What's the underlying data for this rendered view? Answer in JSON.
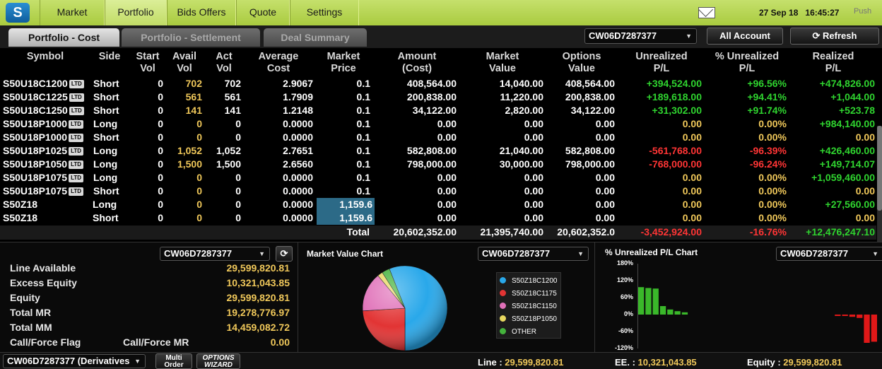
{
  "nav": {
    "logo": "S",
    "items": [
      "Market",
      "Portfolio",
      "Bids Offers",
      "Quote",
      "Settings"
    ],
    "active": "Portfolio",
    "date": "27 Sep 18",
    "time": "16:45:27",
    "push": "Push"
  },
  "tabs": [
    "Portfolio - Cost",
    "Portfolio - Settlement",
    "Deal Summary"
  ],
  "toolbar": {
    "account": "CW06D7287377",
    "all_account": "All Account",
    "refresh": "Refresh"
  },
  "table": {
    "headers": [
      [
        "Symbol",
        ""
      ],
      [
        "Side",
        ""
      ],
      [
        "Start",
        "Vol"
      ],
      [
        "Avail",
        "Vol"
      ],
      [
        "Act",
        "Vol"
      ],
      [
        "Average",
        "Cost"
      ],
      [
        "Market",
        "Price"
      ],
      [
        "Amount",
        "(Cost)"
      ],
      [
        "Market",
        "Value"
      ],
      [
        "Options",
        "Value"
      ],
      [
        "Unrealized",
        "P/L"
      ],
      [
        "% Unrealized",
        "P/L"
      ],
      [
        "Realized",
        "P/L"
      ]
    ],
    "ltd_label": "LTD",
    "rows": [
      {
        "symbol": "S50U18C1200",
        "ltd": true,
        "side": "Short",
        "start": "0",
        "avail": "702",
        "act": "702",
        "avg": "2.9067",
        "mkt": "0.1",
        "amount": "408,564.00",
        "mval": "14,040.00",
        "oval": "408,564.00",
        "unr": "+394,524.00",
        "pct": "+96.56%",
        "real": "+474,826.00"
      },
      {
        "symbol": "S50U18C1225",
        "ltd": true,
        "side": "Short",
        "start": "0",
        "avail": "561",
        "act": "561",
        "avg": "1.7909",
        "mkt": "0.1",
        "amount": "200,838.00",
        "mval": "11,220.00",
        "oval": "200,838.00",
        "unr": "+189,618.00",
        "pct": "+94.41%",
        "real": "+1,044.00"
      },
      {
        "symbol": "S50U18C1250",
        "ltd": true,
        "side": "Short",
        "start": "0",
        "avail": "141",
        "act": "141",
        "avg": "1.2148",
        "mkt": "0.1",
        "amount": "34,122.00",
        "mval": "2,820.00",
        "oval": "34,122.00",
        "unr": "+31,302.00",
        "pct": "+91.74%",
        "real": "+523.78"
      },
      {
        "symbol": "S50U18P1000",
        "ltd": true,
        "side": "Long",
        "start": "0",
        "avail": "0",
        "act": "0",
        "avg": "0.0000",
        "mkt": "0.1",
        "amount": "0.00",
        "mval": "0.00",
        "oval": "0.00",
        "unr": "0.00",
        "pct": "0.00%",
        "real": "+984,140.00"
      },
      {
        "symbol": "S50U18P1000",
        "ltd": true,
        "side": "Short",
        "start": "0",
        "avail": "0",
        "act": "0",
        "avg": "0.0000",
        "mkt": "0.1",
        "amount": "0.00",
        "mval": "0.00",
        "oval": "0.00",
        "unr": "0.00",
        "pct": "0.00%",
        "real": "0.00"
      },
      {
        "symbol": "S50U18P1025",
        "ltd": true,
        "side": "Long",
        "start": "0",
        "avail": "1,052",
        "act": "1,052",
        "avg": "2.7651",
        "mkt": "0.1",
        "amount": "582,808.00",
        "mval": "21,040.00",
        "oval": "582,808.00",
        "unr": "-561,768.00",
        "pct": "-96.39%",
        "real": "+426,460.00"
      },
      {
        "symbol": "S50U18P1050",
        "ltd": true,
        "side": "Long",
        "start": "0",
        "avail": "1,500",
        "act": "1,500",
        "avg": "2.6560",
        "mkt": "0.1",
        "amount": "798,000.00",
        "mval": "30,000.00",
        "oval": "798,000.00",
        "unr": "-768,000.00",
        "pct": "-96.24%",
        "real": "+149,714.07"
      },
      {
        "symbol": "S50U18P1075",
        "ltd": true,
        "side": "Long",
        "start": "0",
        "avail": "0",
        "act": "0",
        "avg": "0.0000",
        "mkt": "0.1",
        "amount": "0.00",
        "mval": "0.00",
        "oval": "0.00",
        "unr": "0.00",
        "pct": "0.00%",
        "real": "+1,059,460.00"
      },
      {
        "symbol": "S50U18P1075",
        "ltd": true,
        "side": "Short",
        "start": "0",
        "avail": "0",
        "act": "0",
        "avg": "0.0000",
        "mkt": "0.1",
        "amount": "0.00",
        "mval": "0.00",
        "oval": "0.00",
        "unr": "0.00",
        "pct": "0.00%",
        "real": "0.00"
      },
      {
        "symbol": "S50Z18",
        "ltd": false,
        "side": "Long",
        "start": "0",
        "avail": "0",
        "act": "0",
        "avg": "0.0000",
        "mkt": "1,159.6",
        "amount": "0.00",
        "mval": "0.00",
        "oval": "0.00",
        "unr": "0.00",
        "pct": "0.00%",
        "real": "+27,560.00"
      },
      {
        "symbol": "S50Z18",
        "ltd": false,
        "side": "Short",
        "start": "0",
        "avail": "0",
        "act": "0",
        "avg": "0.0000",
        "mkt": "1,159.6",
        "amount": "0.00",
        "mval": "0.00",
        "oval": "0.00",
        "unr": "0.00",
        "pct": "0.00%",
        "real": "0.00"
      }
    ],
    "total": {
      "label": "Total",
      "amount": "20,602,352.00",
      "mval": "21,395,740.00",
      "oval": "20,602,352.0",
      "unr": "-3,452,924.00",
      "pct": "-16.76%",
      "real": "+12,476,247.10"
    }
  },
  "account_panel": {
    "account": "CW06D7287377",
    "rows": [
      {
        "label": "Line Available",
        "value": "29,599,820.81"
      },
      {
        "label": "Excess Equity",
        "value": "10,321,043.85"
      },
      {
        "label": "Equity",
        "value": "29,599,820.81"
      },
      {
        "label": "Total MR",
        "value": "19,278,776.97"
      },
      {
        "label": "Total MM",
        "value": "14,459,082.72"
      }
    ],
    "flag_label": "Call/Force Flag",
    "flag_value": "Call/Force MR",
    "flag_num": "0.00"
  },
  "market_value_chart": {
    "title": "Market Value Chart",
    "account": "CW06D7287377",
    "chart_data": {
      "type": "pie",
      "labels": [
        "S50Z18C1200",
        "S50Z18C1175",
        "S50Z18C1150",
        "S50Z18P1050",
        "OTHER"
      ],
      "values": [
        56,
        24,
        15,
        2,
        3
      ],
      "colors": [
        "#29a8ea",
        "#e23434",
        "#e070b8",
        "#e8d860",
        "#44b33c"
      ]
    }
  },
  "unrealized_chart": {
    "title": "% Unrealized P/L Chart",
    "account": "CW06D7287377",
    "chart_data": {
      "type": "bar",
      "yticks": [
        "180%",
        "120%",
        "60%",
        "0%",
        "-60%",
        "-120%"
      ],
      "ylim": [
        -120,
        180
      ],
      "values": [
        97,
        94,
        92,
        30,
        18,
        12,
        8,
        0,
        0,
        0,
        0,
        0,
        0,
        0,
        0,
        0,
        0,
        0,
        0,
        0,
        0,
        0,
        0,
        0,
        0,
        0,
        0,
        -5,
        -5,
        -8,
        -12,
        -100,
        -96
      ],
      "colors": {
        "positive": "#3ab82a",
        "negative": "#e01818"
      }
    }
  },
  "status": {
    "account": "CW06D7287377 (Derivatives",
    "multi_order": [
      "Multi",
      "Order"
    ],
    "options_wizard": [
      "OPTIONS",
      "WIZARD"
    ],
    "line_label": "Line :",
    "line_value": "29,599,820.81",
    "ee_label": "EE. :",
    "ee_value": "10,321,043.85",
    "equity_label": "Equity :",
    "equity_value": "29,599,820.81"
  }
}
